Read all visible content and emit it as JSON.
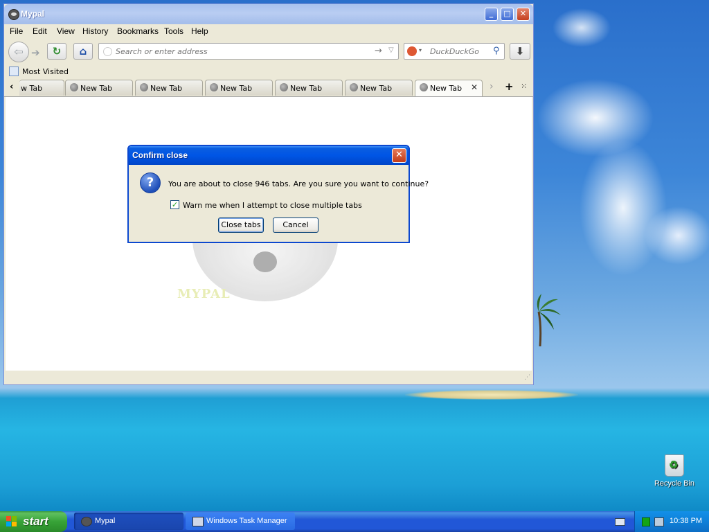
{
  "window": {
    "title": "Mypal",
    "minimize": "_",
    "maximize": "□",
    "close": "✕"
  },
  "menu": [
    {
      "label": "File"
    },
    {
      "label": "Edit"
    },
    {
      "label": "View"
    },
    {
      "label": "History"
    },
    {
      "label": "Bookmarks"
    },
    {
      "label": "Tools"
    },
    {
      "label": "Help"
    }
  ],
  "navbar": {
    "url_placeholder": "Search or enter address",
    "search_placeholder": "DuckDuckGo",
    "back_icon": "back-arrow-icon",
    "forward_icon": "forward-arrow-icon",
    "reload_icon": "reload-icon",
    "home_icon": "home-icon",
    "download_icon": "download-icon"
  },
  "bookmarks": {
    "most_visited": "Most Visited"
  },
  "tabs": [
    {
      "label": "w Tab"
    },
    {
      "label": "New Tab"
    },
    {
      "label": "New Tab"
    },
    {
      "label": "New Tab"
    },
    {
      "label": "New Tab"
    },
    {
      "label": "New Tab"
    },
    {
      "label": "New Tab",
      "active": true
    }
  ],
  "page": {
    "watermark_text": "MYPAL"
  },
  "dialog": {
    "title": "Confirm close",
    "message": "You are about to close 946 tabs. Are you sure you want to continue?",
    "checkbox_label": "Warn me when I attempt to close multiple tabs",
    "checkbox_checked": true,
    "close_tabs_button": "Close tabs",
    "cancel_button": "Cancel"
  },
  "desktop": {
    "recycle_bin": "Recycle Bin"
  },
  "taskbar": {
    "start": "start",
    "tasks": [
      {
        "label": "Mypal",
        "active": true
      },
      {
        "label": "Windows Task Manager",
        "active": false
      }
    ],
    "clock": "10:38 PM"
  },
  "colors": {
    "xp_blue": "#0055e5",
    "start_green": "#37a337",
    "window_face": "#ece9d8"
  }
}
